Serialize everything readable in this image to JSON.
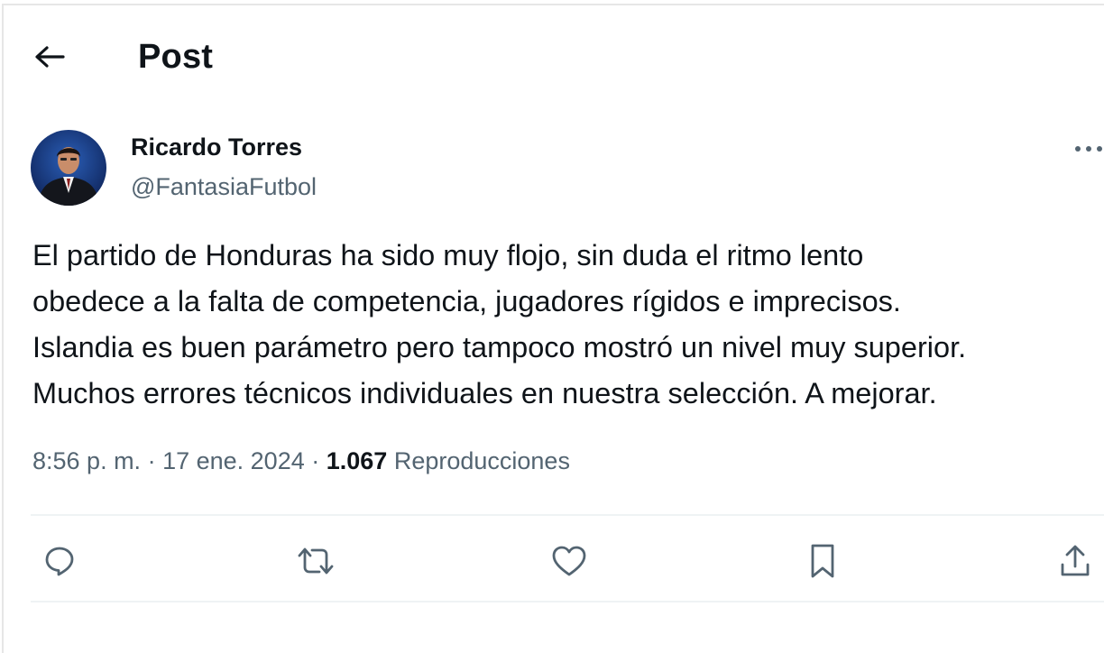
{
  "header": {
    "title": "Post"
  },
  "post": {
    "author": {
      "display_name": "Ricardo Torres",
      "handle": "@FantasiaFutbol"
    },
    "text_lines": [
      "El partido de Honduras ha sido muy flojo, sin duda el ritmo lento",
      "obedece a la falta de competencia, jugadores rígidos e imprecisos.",
      "Islandia es buen parámetro pero tampoco mostró un nivel muy superior.",
      "Muchos errores técnicos individuales en nuestra selección. A mejorar."
    ],
    "meta": {
      "time": "8:56 p. m.",
      "separator": " · ",
      "date": "17 ene. 2024",
      "views_count": "1.067",
      "views_label": "Reproducciones"
    }
  },
  "icons": {
    "back": "arrow-left-icon",
    "more": "more-horizontal-icon",
    "reply": "reply-bubble-icon",
    "repost": "repost-icon",
    "like": "heart-icon",
    "bookmark": "bookmark-icon",
    "share": "share-upload-icon"
  },
  "colors": {
    "text_primary": "#0f1419",
    "text_secondary": "#536471",
    "divider": "#eff3f4"
  }
}
